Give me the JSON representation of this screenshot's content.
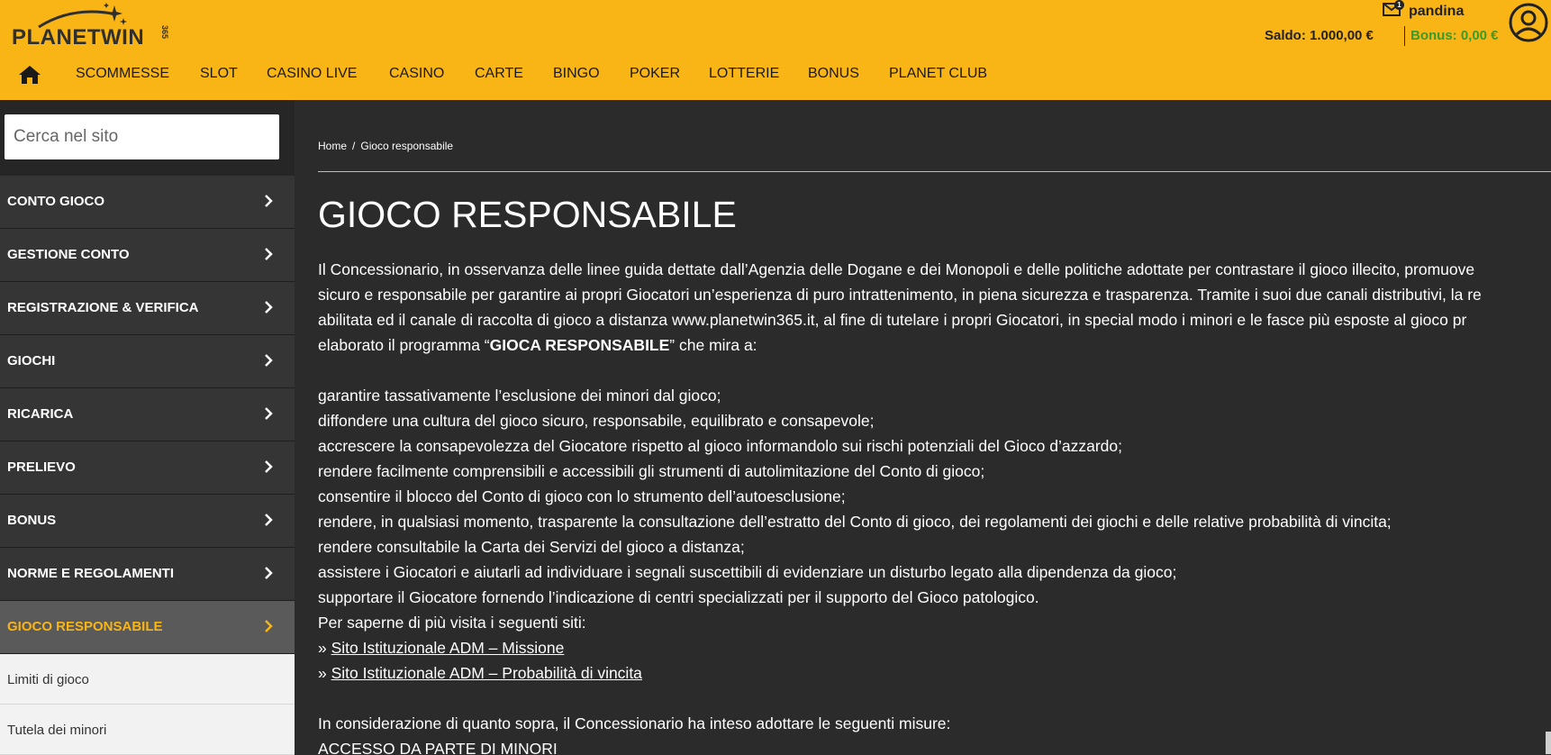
{
  "brand": {
    "logo_text": "PLANETWIN",
    "logo_suffix": "365"
  },
  "user": {
    "mail_count": "1",
    "username": "pandina",
    "saldo": "Saldo: 1.000,00 €",
    "bonus": "Bonus: 0,00 €"
  },
  "nav": {
    "items": [
      "SCOMMESSE",
      "SLOT",
      "CASINO LIVE",
      "CASINO",
      "CARTE",
      "BINGO",
      "POKER",
      "LOTTERIE",
      "BONUS",
      "PLANET CLUB"
    ]
  },
  "sidebar": {
    "search_placeholder": "Cerca nel sito",
    "items": [
      "CONTO GIOCO",
      "GESTIONE CONTO",
      "REGISTRAZIONE & VERIFICA",
      "GIOCHI",
      "RICARICA",
      "PRELIEVO",
      "BONUS",
      "NORME E REGOLAMENTI",
      "GIOCO RESPONSABILE"
    ],
    "active_index": 8,
    "subitems": [
      "Limiti di gioco",
      "Tutela dei minori"
    ]
  },
  "breadcrumb": {
    "home": "Home",
    "separator": "/",
    "current": "Gioco responsabile"
  },
  "page": {
    "title": "GIOCO RESPONSABILE",
    "intro": [
      "Il Concessionario, in osservanza delle linee guida dettate dall’Agenzia delle Dogane e dei Monopoli e delle politiche adottate per contrastare il gioco illecito, promuove",
      "sicuro e responsabile per garantire ai propri Giocatori un’esperienza di puro intrattenimento, in piena sicurezza e trasparenza. Tramite i suoi due canali distributivi, la re",
      "abilitata ed il canale di raccolta di gioco a distanza www.planetwin365.it, al fine di tutelare i propri Giocatori, in special modo i minori e le fasce più esposte al gioco pr"
    ],
    "intro_last_before": "elaborato il programma “",
    "intro_last_bold": "GIOCA RESPONSABILE",
    "intro_last_after": "” che mira a:",
    "list": [
      "garantire tassativamente l’esclusione dei minori dal gioco;",
      "diffondere una cultura del gioco sicuro, responsabile, equilibrato e consapevole;",
      "accrescere la consapevolezza del Giocatore rispetto al gioco informandolo sui rischi potenziali del Gioco d’azzardo;",
      "rendere facilmente comprensibili e accessibili gli strumenti di autolimitazione del Conto di gioco;",
      "consentire il blocco del Conto di gioco con lo strumento dell’autoesclusione;",
      "rendere, in qualsiasi momento, trasparente la consultazione dell’estratto del Conto di gioco, dei regolamenti dei giochi e delle relative probabilità di vincita;",
      "rendere consultabile la Carta dei Servizi del gioco a distanza;",
      "assistere i Giocatori e aiutarli ad individuare i segnali suscettibili di evidenziare un disturbo legato alla dipendenza da gioco;",
      "supportare il Giocatore fornendo l’indicazione di centri specializzati per il supporto del Gioco patologico."
    ],
    "links_intro": "Per saperne di più visita i seguenti siti:",
    "link_prefix": "» ",
    "links": [
      "Sito Istituzionale ADM – Missione",
      "Sito Istituzionale ADM – Probabilità di vincita"
    ],
    "closing": "In considerazione di quanto sopra, il Concessionario ha inteso adottare le seguenti misure:",
    "section_heading": "ACCESSO DA PARTE DI MINORI"
  },
  "colors": {
    "header": "#f9b516",
    "sidebar": "#353535",
    "content_bg": "#2b2b2b",
    "accent": "#f9b516",
    "bonus": "#3a9b2a"
  },
  "icons": {
    "home": "home-icon",
    "mail": "mail-icon",
    "avatar": "user-avatar-icon",
    "chevron": "chevron-right-icon"
  }
}
